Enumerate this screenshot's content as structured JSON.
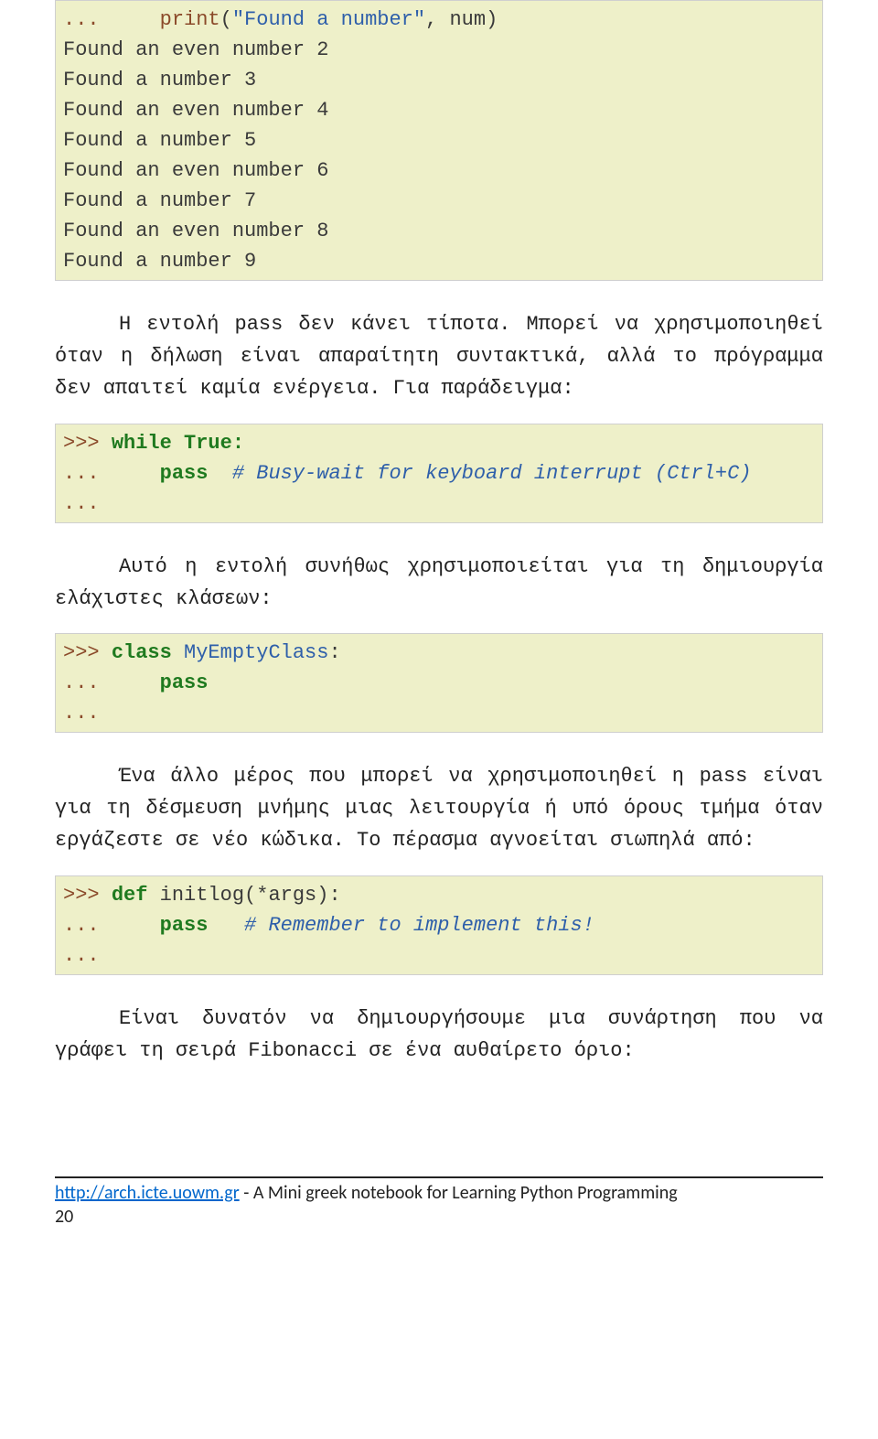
{
  "code1": {
    "l1_prompt": "...",
    "l1_print": "print",
    "l1_paren_open": "(",
    "l1_str": "\"Found a number\"",
    "l1_rest": ", num)",
    "out1": "Found an even number 2",
    "out2": "Found a number 3",
    "out3": "Found an even number 4",
    "out4": "Found a number 5",
    "out5": "Found an even number 6",
    "out6": "Found a number 7",
    "out7": "Found an even number 8",
    "out8": "Found a number 9"
  },
  "para1": "Η εντολή pass δεν κάνει τίποτα. Μπορεί να χρησιμοποιηθεί όταν η δήλωση είναι απαραίτητη συντακτικά, αλλά το πρόγραμμα δεν απαιτεί καμία ενέργεια. Για παράδειγμα:",
  "code2": {
    "l1_prompt": ">>> ",
    "l1_while": "while",
    "l1_true": " True:",
    "l2_prompt": "...     ",
    "l2_pass": "pass",
    "l2_comment": "  # Busy-wait for keyboard interrupt (Ctrl+C)",
    "l3_prompt": "..."
  },
  "para2": "Αυτό η εντολή συνήθως χρησιμοποιείται για τη δημιουργία ελάχιστες κλάσεων:",
  "code3": {
    "l1_prompt": ">>> ",
    "l1_class": "class",
    "l1_name": " MyEmptyClass",
    "l1_colon": ":",
    "l2_prompt": "...     ",
    "l2_pass": "pass",
    "l3_prompt": "..."
  },
  "para3": "Ένα άλλο μέρος που μπορεί να χρησιμοποιηθεί η pass είναι για τη δέσμευση μνήμης μιας λειτουργία ή υπό όρους τμήμα όταν εργάζεστε σε νέο κώδικα. Το πέρασμα αγνοείται σιωπηλά από:",
  "code4": {
    "l1_prompt": ">>> ",
    "l1_def": "def",
    "l1_name": " initlog(*args):",
    "l2_prompt": "...     ",
    "l2_pass": "pass",
    "l2_comment": "   # Remember to implement this!",
    "l3_prompt": "..."
  },
  "para4": "Είναι δυνατόν να δημιουργήσουμε μια συνάρτηση που να γράφει τη σειρά Fibonacci σε ένα αυθαίρετο όριο:",
  "footer": {
    "link": "http://arch.icte.uowm.gr",
    "rest": " - A Mini greek notebook for Learning Python Programming",
    "page": "20"
  }
}
